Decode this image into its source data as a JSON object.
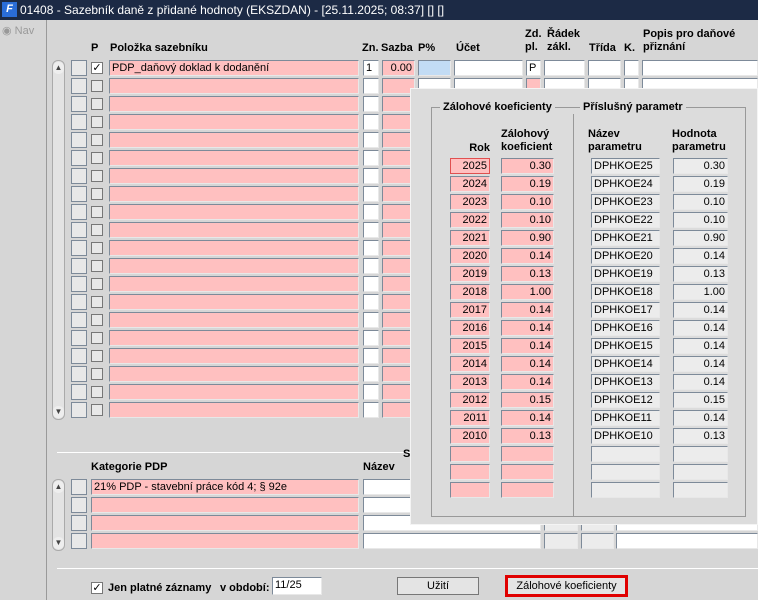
{
  "window": {
    "title": "01408 - Sazebník daně z přidané hodnoty (EKSZDAN) - [25.11.2025; 08:37]  [] []",
    "logo": "F"
  },
  "nav": {
    "label": "Nav"
  },
  "main_table": {
    "headers": {
      "p": "P",
      "polozka": "Položka sazebníku",
      "zn": "Zn.",
      "sazba": "Sazba",
      "pp": "P%",
      "ucet": "Účet",
      "zdpl": "Zd. pl.",
      "radek": "Řádek zákl.",
      "trida": "Třída",
      "k": "K.",
      "popis": "Popis pro daňové přiznání"
    },
    "rows": [
      {
        "checked": true,
        "polozka": "PDP_daňový doklad k dodanění",
        "zn": "1",
        "sazba": "0.00",
        "zdpl": "P"
      }
    ],
    "row_count": 20
  },
  "category_table": {
    "headers": {
      "kategorie": "Kategorie PDP",
      "nazev": "Název",
      "s": "S"
    },
    "rows": [
      {
        "kategorie": "21% PDP - stavební práce kód 4; § 92e"
      }
    ],
    "row_count": 4
  },
  "footer": {
    "only_valid_label": "Jen platné záznamy",
    "only_valid_checked": true,
    "period_label": "v období:",
    "period_value": "11/25",
    "usage_button": "Užití",
    "coefficients_button": "Zálohové koeficienty"
  },
  "popup": {
    "group1": "Zálohové koeficienty",
    "group2": "Příslušný parametr",
    "headers": {
      "rok": "Rok",
      "koef": "Zálohový koeficient",
      "nazev": "Název parametru",
      "hodnota": "Hodnota parametru"
    },
    "rows": [
      {
        "rok": "2025",
        "koef": "0.30",
        "nazev": "DPHKOE25",
        "hodnota": "0.30"
      },
      {
        "rok": "2024",
        "koef": "0.19",
        "nazev": "DPHKOE24",
        "hodnota": "0.19"
      },
      {
        "rok": "2023",
        "koef": "0.10",
        "nazev": "DPHKOE23",
        "hodnota": "0.10"
      },
      {
        "rok": "2022",
        "koef": "0.10",
        "nazev": "DPHKOE22",
        "hodnota": "0.10"
      },
      {
        "rok": "2021",
        "koef": "0.90",
        "nazev": "DPHKOE21",
        "hodnota": "0.90"
      },
      {
        "rok": "2020",
        "koef": "0.14",
        "nazev": "DPHKOE20",
        "hodnota": "0.14"
      },
      {
        "rok": "2019",
        "koef": "0.13",
        "nazev": "DPHKOE19",
        "hodnota": "0.13"
      },
      {
        "rok": "2018",
        "koef": "1.00",
        "nazev": "DPHKOE18",
        "hodnota": "1.00"
      },
      {
        "rok": "2017",
        "koef": "0.14",
        "nazev": "DPHKOE17",
        "hodnota": "0.14"
      },
      {
        "rok": "2016",
        "koef": "0.14",
        "nazev": "DPHKOE16",
        "hodnota": "0.14"
      },
      {
        "rok": "2015",
        "koef": "0.14",
        "nazev": "DPHKOE15",
        "hodnota": "0.14"
      },
      {
        "rok": "2014",
        "koef": "0.14",
        "nazev": "DPHKOE14",
        "hodnota": "0.14"
      },
      {
        "rok": "2013",
        "koef": "0.14",
        "nazev": "DPHKOE13",
        "hodnota": "0.14"
      },
      {
        "rok": "2012",
        "koef": "0.15",
        "nazev": "DPHKOE12",
        "hodnota": "0.15"
      },
      {
        "rok": "2011",
        "koef": "0.14",
        "nazev": "DPHKOE11",
        "hodnota": "0.14"
      },
      {
        "rok": "2010",
        "koef": "0.13",
        "nazev": "DPHKOE10",
        "hodnota": "0.13"
      }
    ],
    "empty_rows": 3
  },
  "colors": {
    "title_bg": "#1c2a45",
    "required": "#ffc0c0",
    "selected": "#c2dcf5",
    "highlight": "#e00000"
  }
}
